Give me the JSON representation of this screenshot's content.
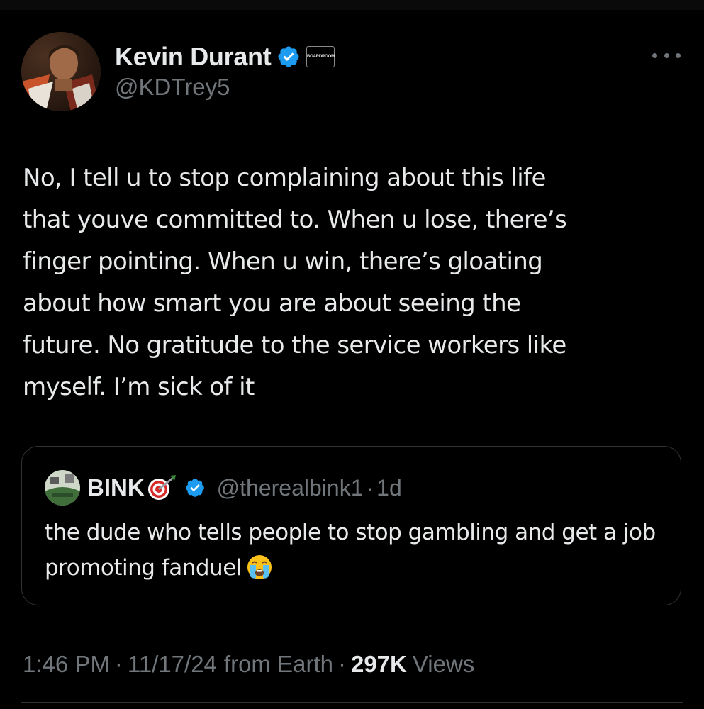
{
  "author": {
    "display_name": "Kevin Durant",
    "handle": "@KDTrey5",
    "avatar_icon": "profile-photo",
    "verified_icon": "verified-badge-icon",
    "affiliate_badge": "BOARDROOM"
  },
  "tweet": {
    "text": "No, I tell u to stop complaining about this life\nthat youve committed to. When u lose, there’s\nfinger pointing. When u win, there’s gloating\nabout how smart you are about seeing the\nfuture. No gratitude to the service workers like\nmyself. I’m sick of it"
  },
  "quote": {
    "display_name": "BINK",
    "name_emoji_icon": "dart-target-icon",
    "handle": "@therealbink1",
    "separator": "·",
    "age": "1d",
    "text": "the dude who tells people to stop gambling and get a job promoting fanduel",
    "text_emoji_icon": "loudly-crying-face-icon"
  },
  "meta": {
    "time": "1:46 PM",
    "date": "11/17/24",
    "location": "from Earth",
    "separator": "·",
    "views_count": "297K",
    "views_label": "Views"
  },
  "colors": {
    "background": "#000000",
    "primary_text": "#e7e9ea",
    "secondary_text": "#71767b",
    "verified_blue": "#1d9bf0",
    "border": "#2f3336"
  }
}
